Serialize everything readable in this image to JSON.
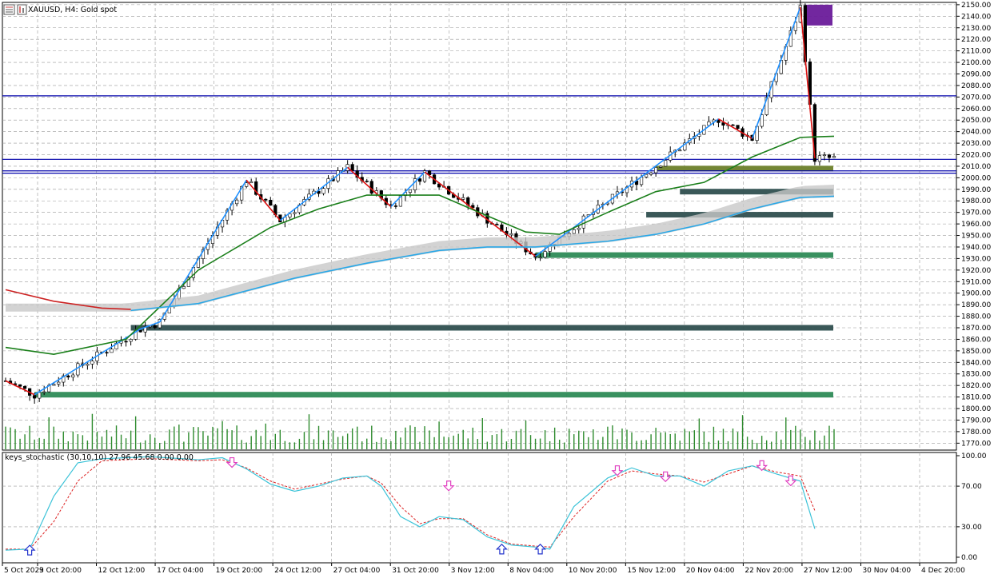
{
  "header": {
    "symbol_label": "XAUUSD, H4:  Gold spot"
  },
  "indicator": {
    "label": "keys_stochastic (30,10,10) 27.96 45.68 0.00 0.00",
    "axis_labels": [
      "100.00",
      "70.00",
      "30.00",
      "0.00"
    ]
  },
  "chart_data": {
    "type": "line",
    "title": "XAUUSD, H4:  Gold spot",
    "price_axis": {
      "ylim": [
        1764,
        2152
      ],
      "tick_labels": [
        "2150.00",
        "2140.00",
        "2130.00",
        "2120.00",
        "2110.00",
        "2100.00",
        "2090.00",
        "2080.00",
        "2070.00",
        "2060.00",
        "2050.00",
        "2040.00",
        "2030.00",
        "2020.00",
        "2010.00",
        "2000.00",
        "1990.00",
        "1980.00",
        "1970.00",
        "1960.00",
        "1950.00",
        "1940.00",
        "1930.00",
        "1920.00",
        "1910.00",
        "1900.00",
        "1890.00",
        "1880.00",
        "1870.00",
        "1860.00",
        "1850.00",
        "1840.00",
        "1830.00",
        "1820.00",
        "1810.00",
        "1800.00",
        "1790.00",
        "1780.00",
        "1770.00"
      ]
    },
    "x_tick_labels": [
      "5 Oct 2023",
      "9 Oct 20:00",
      "12 Oct 12:00",
      "17 Oct 04:00",
      "19 Oct 20:00",
      "24 Oct 12:00",
      "27 Oct 04:00",
      "31 Oct 20:00",
      "3 Nov 12:00",
      "8 Nov 04:00",
      "10 Nov 20:00",
      "15 Nov 12:00",
      "20 Nov 04:00",
      "22 Nov 20:00",
      "27 Nov 12:00",
      "30 Nov 04:00",
      "4 Dec 20:00"
    ],
    "grid": true,
    "horizontal_levels": [
      2071,
      2016,
      2006,
      2004
    ],
    "price_series": [
      {
        "name": "zigzag",
        "color": "#1e90ff",
        "points": [
          [
            0,
            1824
          ],
          [
            6,
            1812
          ],
          [
            28,
            1869
          ],
          [
            32,
            1875
          ],
          [
            50,
            1998
          ],
          [
            57,
            1963
          ],
          [
            71,
            2009
          ],
          [
            80,
            1975
          ],
          [
            87,
            2005
          ],
          [
            110,
            1932
          ],
          [
            148,
            2051
          ],
          [
            155,
            2034
          ],
          [
            165,
            2148
          ],
          [
            168,
            2017
          ]
        ]
      },
      {
        "name": "fast-ma",
        "color": "#1a7f1a",
        "points": [
          [
            0,
            1853
          ],
          [
            10,
            1847
          ],
          [
            25,
            1860
          ],
          [
            40,
            1920
          ],
          [
            55,
            1957
          ],
          [
            65,
            1973
          ],
          [
            75,
            1985
          ],
          [
            90,
            1985
          ],
          [
            100,
            1967
          ],
          [
            108,
            1953
          ],
          [
            115,
            1951
          ],
          [
            125,
            1970
          ],
          [
            135,
            1988
          ],
          [
            145,
            1996
          ],
          [
            155,
            2018
          ],
          [
            165,
            2035
          ],
          [
            172,
            2036
          ]
        ]
      },
      {
        "name": "slow-ma",
        "color": "#29a8e8",
        "points": [
          [
            26,
            1885
          ],
          [
            40,
            1891
          ],
          [
            60,
            1913
          ],
          [
            75,
            1926
          ],
          [
            90,
            1937
          ],
          [
            100,
            1940
          ],
          [
            110,
            1940
          ],
          [
            125,
            1945
          ],
          [
            135,
            1951
          ],
          [
            145,
            1960
          ],
          [
            155,
            1973
          ],
          [
            165,
            1983
          ],
          [
            172,
            1984
          ]
        ]
      },
      {
        "name": "long-ma",
        "color": "#cc2222",
        "points": [
          [
            0,
            1903
          ],
          [
            10,
            1893
          ],
          [
            20,
            1887
          ],
          [
            26,
            1886
          ]
        ]
      }
    ],
    "zones": [
      {
        "price": 1812,
        "color": "#2e8b57"
      },
      {
        "price": 1870,
        "color": "#2f4f4f"
      },
      {
        "price": 1933,
        "color": "#2e8b57"
      },
      {
        "price": 1968,
        "color": "#2f4f4f"
      },
      {
        "price": 1988,
        "color": "#2f4f4f"
      },
      {
        "price": 2008,
        "color": "#6b7f2a"
      },
      {
        "price": 2141,
        "color": "#6a1b9a"
      }
    ],
    "stochastic": {
      "ylim": [
        0,
        100
      ],
      "main": [
        [
          0,
          7
        ],
        [
          5,
          8
        ],
        [
          10,
          60
        ],
        [
          15,
          93
        ],
        [
          20,
          97
        ],
        [
          30,
          99
        ],
        [
          40,
          96
        ],
        [
          45,
          98
        ],
        [
          50,
          87
        ],
        [
          55,
          72
        ],
        [
          60,
          65
        ],
        [
          65,
          70
        ],
        [
          70,
          78
        ],
        [
          75,
          80
        ],
        [
          78,
          70
        ],
        [
          82,
          40
        ],
        [
          86,
          30
        ],
        [
          90,
          40
        ],
        [
          95,
          37
        ],
        [
          100,
          20
        ],
        [
          105,
          12
        ],
        [
          110,
          10
        ],
        [
          113,
          8
        ],
        [
          118,
          50
        ],
        [
          125,
          78
        ],
        [
          130,
          88
        ],
        [
          135,
          80
        ],
        [
          140,
          80
        ],
        [
          145,
          70
        ],
        [
          150,
          85
        ],
        [
          155,
          90
        ],
        [
          160,
          82
        ],
        [
          165,
          75
        ],
        [
          168,
          28
        ]
      ],
      "signal": [
        [
          0,
          8
        ],
        [
          5,
          8
        ],
        [
          10,
          35
        ],
        [
          15,
          75
        ],
        [
          20,
          95
        ],
        [
          30,
          97
        ],
        [
          40,
          95
        ],
        [
          45,
          96
        ],
        [
          50,
          88
        ],
        [
          55,
          75
        ],
        [
          60,
          67
        ],
        [
          65,
          72
        ],
        [
          70,
          77
        ],
        [
          75,
          80
        ],
        [
          78,
          73
        ],
        [
          82,
          50
        ],
        [
          86,
          33
        ],
        [
          90,
          38
        ],
        [
          95,
          38
        ],
        [
          100,
          22
        ],
        [
          105,
          13
        ],
        [
          110,
          11
        ],
        [
          113,
          10
        ],
        [
          118,
          40
        ],
        [
          125,
          75
        ],
        [
          130,
          85
        ],
        [
          135,
          82
        ],
        [
          140,
          80
        ],
        [
          145,
          74
        ],
        [
          150,
          82
        ],
        [
          155,
          90
        ],
        [
          160,
          84
        ],
        [
          165,
          80
        ],
        [
          168,
          46
        ]
      ],
      "up_arrows": [
        [
          5,
          7
        ],
        [
          103,
          8
        ],
        [
          111,
          8
        ]
      ],
      "down_arrows": [
        [
          47,
          98
        ],
        [
          92,
          75
        ],
        [
          127,
          90
        ],
        [
          137,
          84
        ],
        [
          157,
          95
        ],
        [
          163,
          80
        ]
      ]
    }
  }
}
